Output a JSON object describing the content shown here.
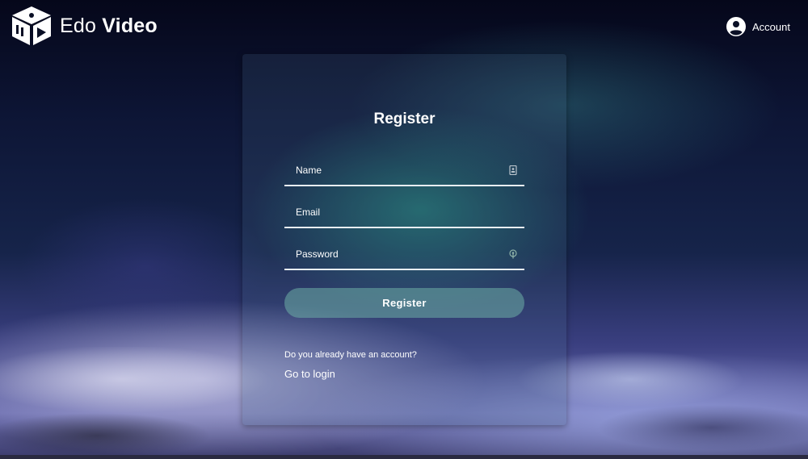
{
  "header": {
    "brand_light": "Edo",
    "brand_bold": "Video",
    "account_label": "Account"
  },
  "form": {
    "title": "Register",
    "name_placeholder": "Name",
    "email_placeholder": "Email",
    "password_placeholder": "Password",
    "submit_label": "Register",
    "login_question": "Do you already have an account?",
    "login_link": "Go to login"
  },
  "icons": {
    "logo": "cube-play-logo-icon",
    "account": "account-circle-icon",
    "name_field": "contact-card-icon",
    "password_field": "key-icon"
  },
  "colors": {
    "button": "#5fa89a",
    "underline": "#e8eef4",
    "text": "#ffffff"
  }
}
